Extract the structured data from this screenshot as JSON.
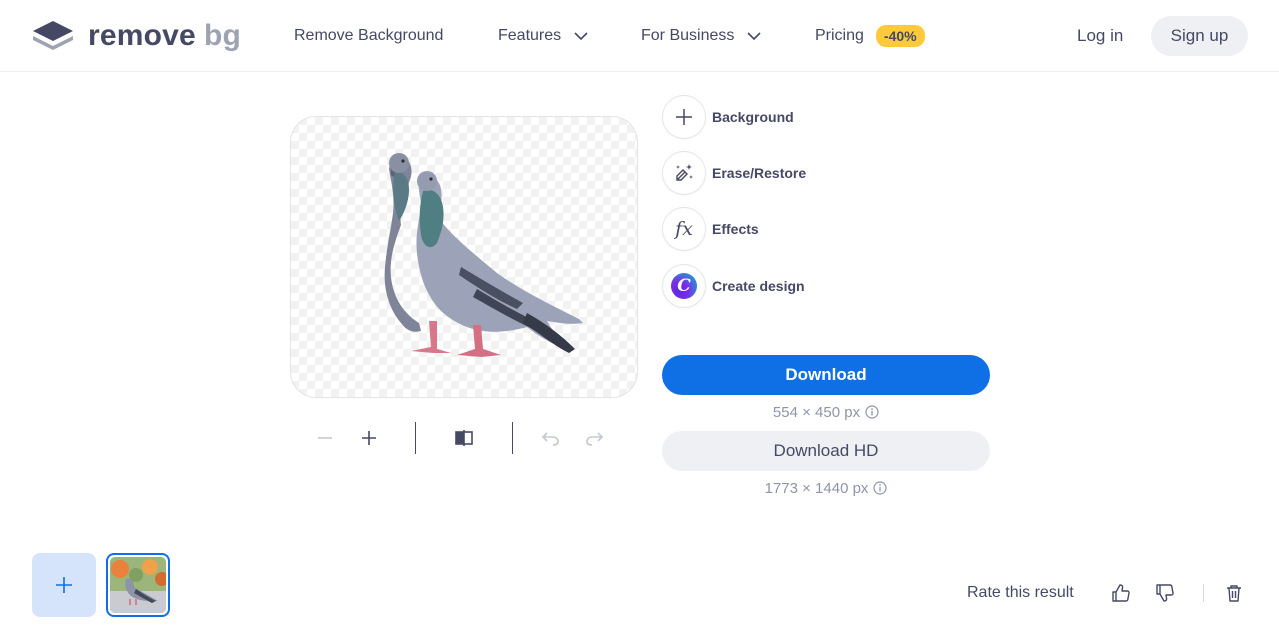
{
  "header": {
    "logo": {
      "word1": "remove",
      "word2": "bg"
    },
    "nav": [
      {
        "label": "Remove Background",
        "has_chevron": false
      },
      {
        "label": "Features",
        "has_chevron": true
      },
      {
        "label": "For Business",
        "has_chevron": true
      },
      {
        "label": "Pricing",
        "badge": "-40%"
      }
    ],
    "login_label": "Log in",
    "signup_label": "Sign up"
  },
  "preview": {
    "icon": "pigeons-cutout-image",
    "background": "transparent-checkerboard"
  },
  "toolbar": {
    "icons": [
      "zoom-out-icon",
      "zoom-in-icon",
      "compare-icon",
      "undo-icon",
      "redo-icon"
    ]
  },
  "tools": [
    {
      "label": "Background",
      "icon": "plus-icon"
    },
    {
      "label": "Erase/Restore",
      "icon": "magic-brush-icon"
    },
    {
      "label": "Effects",
      "icon": "fx-icon",
      "glyph": "fx"
    },
    {
      "label": "Create design",
      "icon": "canva-icon",
      "glyph": "C"
    }
  ],
  "download": {
    "label": "Download",
    "dims": "554 × 450 px",
    "hd_label": "Download HD",
    "hd_dims": "1773 × 1440 px"
  },
  "bottom": {
    "rate_label": "Rate this result",
    "icons": [
      "plus-icon",
      "thumbs-up-icon",
      "thumbs-down-icon",
      "trash-icon"
    ]
  },
  "colors": {
    "primary": "#0f70e6",
    "text": "#454964",
    "muted": "#8f95a8",
    "badge": "#ffc93c",
    "light": "#eef0f3"
  }
}
